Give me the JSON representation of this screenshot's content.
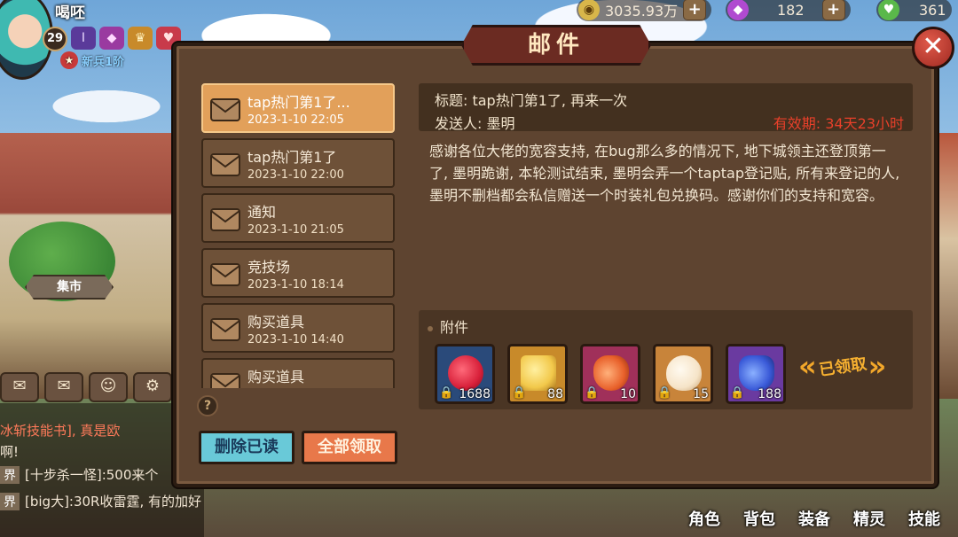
{
  "hud": {
    "player_name": "喝呸",
    "level": "29",
    "rank": "新兵1阶",
    "currencies": [
      {
        "icon": "gold-coin-icon",
        "value": "3035.93万",
        "color": "#d8b64a"
      },
      {
        "icon": "purple-gem-icon",
        "value": "182",
        "color": "#b04ad0"
      },
      {
        "icon": "green-heart-icon",
        "value": "361",
        "color": "#5ab84a"
      }
    ],
    "plus": "+"
  },
  "scene": {
    "market_label": "集市",
    "chat": [
      {
        "tag": "",
        "text": "冰斩技能书], 真是欧"
      },
      {
        "tag": "",
        "text": "啊!"
      },
      {
        "tag": "界",
        "text": "[十步杀一怪]:500来个"
      },
      {
        "tag": "界",
        "text": "[big大]:30R收雷霆, 有的加好"
      }
    ]
  },
  "bottom_nav": [
    "角色",
    "背包",
    "装备",
    "精灵",
    "技能"
  ],
  "dialog": {
    "title": "邮件",
    "close": "✕",
    "help": "?",
    "delete_read": "删除已读",
    "claim_all": "全部领取",
    "mails": [
      {
        "subject": "tap热门第1了...",
        "date": "2023-1-10 22:05",
        "active": true
      },
      {
        "subject": "tap热门第1了",
        "date": "2023-1-10 22:00",
        "active": false
      },
      {
        "subject": "通知",
        "date": "2023-1-10 21:05",
        "active": false
      },
      {
        "subject": "竞技场",
        "date": "2023-1-10 18:14",
        "active": false
      },
      {
        "subject": "购买道具",
        "date": "2023-1-10 14:40",
        "active": false
      },
      {
        "subject": "购买道具",
        "date": "",
        "active": false
      }
    ],
    "detail": {
      "title": "标题: tap热门第1了, 再来一次",
      "sender": "发送人:  墨明",
      "expire": "有效期: 34天23小时",
      "body": "感谢各位大佬的宽容支持, 在bug那么多的情况下, 地下城领主还登顶第一了, 墨明跪谢, 本轮测试结束, 墨明会弄一个taptap登记贴, 所有来登记的人, 墨明不删档都会私信赠送一个时装礼包兑换码。感谢你们的支持和宽容。",
      "attach_label": "附件",
      "attachments": [
        {
          "name": "red-gem-icon",
          "count": "1688",
          "bg": "#2a4a7a",
          "art": "#d8203a"
        },
        {
          "name": "gold-chest-icon",
          "count": "88",
          "bg": "#c88a2a",
          "art": "#f2c84a"
        },
        {
          "name": "potion-icon",
          "count": "10",
          "bg": "#a0305a",
          "art": "#e8602a"
        },
        {
          "name": "egg-icon",
          "count": "15",
          "bg": "#c8843a",
          "art": "#f6e4c8"
        },
        {
          "name": "blue-potion-icon",
          "count": "188",
          "bg": "#6a3aa0",
          "art": "#3a5ad8"
        }
      ],
      "claimed": "已领取"
    }
  }
}
